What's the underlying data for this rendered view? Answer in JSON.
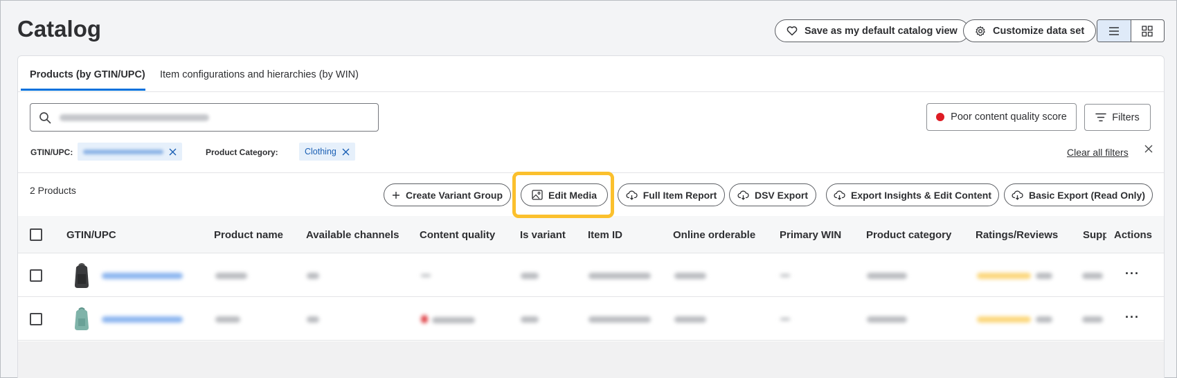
{
  "header": {
    "title": "Catalog",
    "save_default_label": "Save as my default catalog view",
    "customize_label": "Customize data set"
  },
  "tabs": [
    {
      "label": "Products (by GTIN/UPC)",
      "active": true
    },
    {
      "label": "Item configurations and hierarchies (by WIN)",
      "active": false
    }
  ],
  "filters": {
    "poor_quality_label": "Poor content quality score",
    "filters_label": "Filters",
    "gtin_label": "GTIN/UPC:",
    "category_label": "Product Category:",
    "category_value": "Clothing",
    "clear_all_label": "Clear all filters"
  },
  "toolbar": {
    "count_label": "2 Products",
    "create_variant_label": "Create Variant Group",
    "edit_media_label": "Edit Media",
    "full_report_label": "Full Item Report",
    "dsv_export_label": "DSV Export",
    "export_insights_label": "Export Insights & Edit Content",
    "basic_export_label": "Basic Export (Read Only)"
  },
  "table": {
    "columns": [
      "GTIN/UPC",
      "Product name",
      "Available channels",
      "Content quality",
      "Is variant",
      "Item ID",
      "Online orderable",
      "Primary WIN",
      "Product category",
      "Ratings/Reviews",
      "Supp",
      "Actions"
    ],
    "actions_icon": "more-horizontal-icon",
    "rows": [
      {
        "thumbnail": "black-backpack-image"
      },
      {
        "thumbnail": "teal-backpack-image"
      }
    ]
  },
  "colors": {
    "accent": "#0071dc",
    "highlight": "#fbc02d",
    "poor_quality_dot": "#de1c24"
  }
}
